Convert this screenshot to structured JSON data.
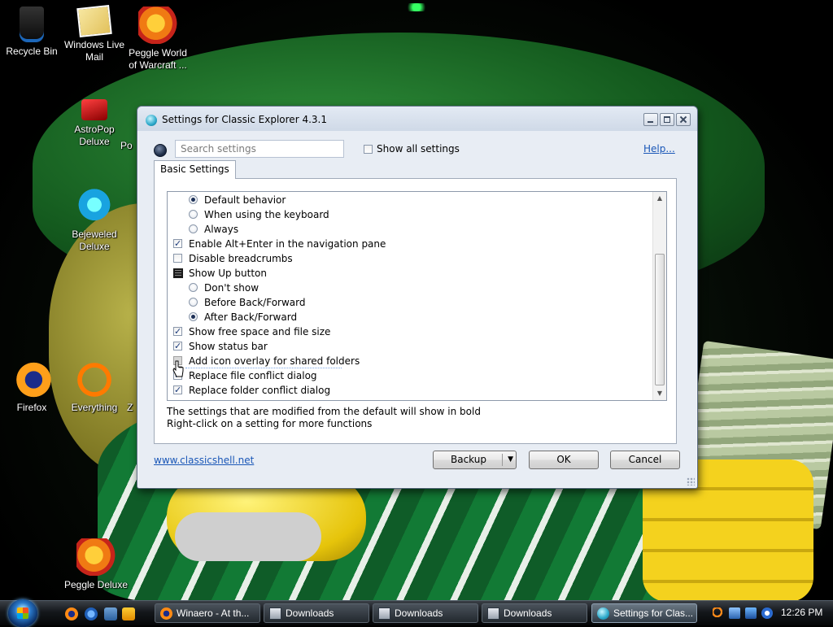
{
  "desktop": {
    "icons": [
      {
        "label_lines": [
          "Recycle Bin"
        ],
        "icon": "recycle-bin-icon"
      },
      {
        "label_lines": [
          "Windows Live",
          "Mail"
        ],
        "icon": "windows-live-mail-icon"
      },
      {
        "label_lines": [
          "Peggle World",
          "of Warcraft ..."
        ],
        "icon": "peggle-icon"
      },
      {
        "label_lines": [
          "AstroPop",
          "Deluxe"
        ],
        "icon": "astropop-icon"
      },
      {
        "label_lines": [
          "Po"
        ],
        "icon": "game-icon"
      },
      {
        "label_lines": [
          "Bejeweled",
          "Deluxe"
        ],
        "icon": "bejeweled-icon"
      },
      {
        "label_lines": [
          "Firefox"
        ],
        "icon": "firefox-icon"
      },
      {
        "label_lines": [
          "Everything"
        ],
        "icon": "everything-icon"
      },
      {
        "label_lines": [
          "Z"
        ],
        "icon": "app-icon"
      },
      {
        "label_lines": [
          "Peggle Deluxe"
        ],
        "icon": "peggle-icon"
      }
    ]
  },
  "dialog": {
    "title": "Settings for Classic Explorer 4.3.1",
    "search": {
      "placeholder": "Search settings",
      "value": ""
    },
    "show_all_label": "Show all settings",
    "show_all_checked": false,
    "help_label": "Help...",
    "tab_label": "Basic Settings",
    "items": [
      {
        "type": "radio",
        "indent": 1,
        "label": "Default behavior",
        "checked": true
      },
      {
        "type": "radio",
        "indent": 1,
        "label": "When using the keyboard",
        "checked": false
      },
      {
        "type": "radio",
        "indent": 1,
        "label": "Always",
        "checked": false
      },
      {
        "type": "checkbox",
        "indent": 0,
        "label": "Enable Alt+Enter in the navigation pane",
        "checked": true
      },
      {
        "type": "checkbox",
        "indent": 0,
        "label": "Disable breadcrumbs",
        "checked": false
      },
      {
        "type": "group",
        "indent": 0,
        "label": "Show Up button"
      },
      {
        "type": "radio",
        "indent": 1,
        "label": "Don't show",
        "checked": false
      },
      {
        "type": "radio",
        "indent": 1,
        "label": "Before Back/Forward",
        "checked": false
      },
      {
        "type": "radio",
        "indent": 1,
        "label": "After Back/Forward",
        "checked": true
      },
      {
        "type": "checkbox",
        "indent": 0,
        "label": "Show free space and file size",
        "checked": true
      },
      {
        "type": "checkbox",
        "indent": 0,
        "label": "Show status bar",
        "checked": true
      },
      {
        "type": "checkbox",
        "indent": 0,
        "label": "Add icon overlay for shared folders",
        "checked": false,
        "disabled": true
      },
      {
        "type": "checkbox",
        "indent": 0,
        "label": "Replace file conflict dialog",
        "checked": true
      },
      {
        "type": "checkbox",
        "indent": 0,
        "label": "Replace folder conflict dialog",
        "checked": true
      }
    ],
    "note_line1": "The settings that are modified from the default will show in bold",
    "note_line2": "Right-click on a setting for more functions",
    "website_label": "www.classicshell.net",
    "backup_label": "Backup",
    "ok_label": "OK",
    "cancel_label": "Cancel"
  },
  "taskbar": {
    "tasks": [
      {
        "label": "Winaero - At th...",
        "icon": "firefox-icon",
        "active": false
      },
      {
        "label": "Downloads",
        "icon": "folder-icon",
        "active": false
      },
      {
        "label": "Downloads",
        "icon": "folder-icon",
        "active": false
      },
      {
        "label": "Downloads",
        "icon": "folder-icon",
        "active": false
      },
      {
        "label": "Settings for Clas...",
        "icon": "classic-explorer-icon",
        "active": true
      }
    ],
    "clock": "12:26 PM"
  }
}
